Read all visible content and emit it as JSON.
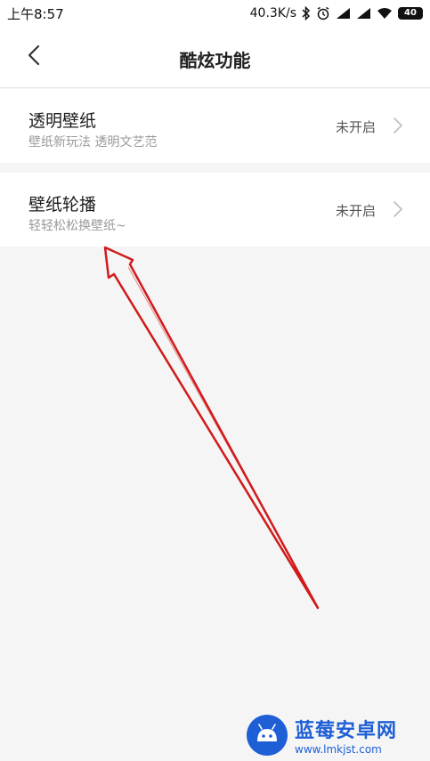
{
  "status_bar": {
    "time": "上午8:57",
    "speed": "40.3K/s",
    "battery": "40"
  },
  "header": {
    "title": "酷炫功能"
  },
  "settings": [
    {
      "title": "透明壁纸",
      "subtitle": "壁纸新玩法 透明文艺范",
      "status": "未开启"
    },
    {
      "title": "壁纸轮播",
      "subtitle": "轻轻松松换壁纸~",
      "status": "未开启"
    }
  ],
  "watermark": {
    "name": "蓝莓安卓网",
    "url": "www.lmkjst.com"
  },
  "colors": {
    "background": "#f5f5f5",
    "card": "#ffffff",
    "annotation": "#d11a1a",
    "watermark": "#1e5fd6"
  }
}
